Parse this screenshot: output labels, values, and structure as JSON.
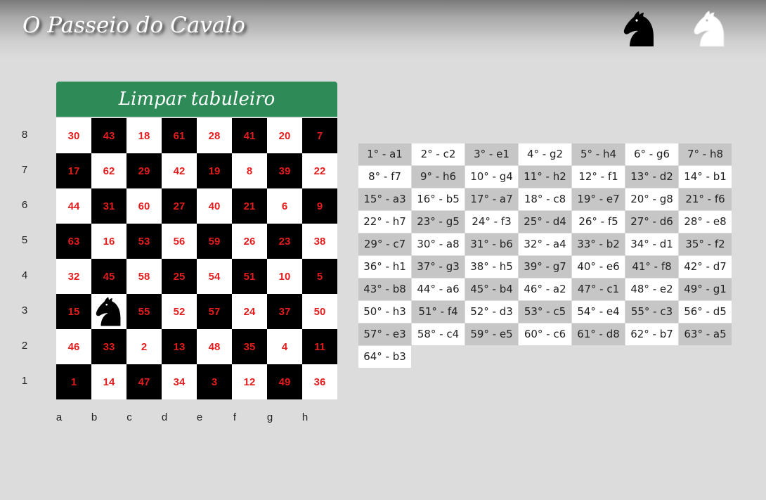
{
  "header": {
    "title": "O Passeio do Cavalo"
  },
  "piece_selectors": [
    {
      "name": "black-knight-icon",
      "color": "#000000"
    },
    {
      "name": "white-knight-icon",
      "color": "#ffffff"
    }
  ],
  "board": {
    "clear_label": "Limpar tabuleiro",
    "ranks": [
      "8",
      "7",
      "6",
      "5",
      "4",
      "3",
      "2",
      "1"
    ],
    "files": [
      "a",
      "b",
      "c",
      "d",
      "e",
      "f",
      "g",
      "h"
    ],
    "rows": [
      [
        "30",
        "43",
        "18",
        "61",
        "28",
        "41",
        "20",
        "7"
      ],
      [
        "17",
        "62",
        "29",
        "42",
        "19",
        "8",
        "39",
        "22"
      ],
      [
        "44",
        "31",
        "60",
        "27",
        "40",
        "21",
        "6",
        "9"
      ],
      [
        "63",
        "16",
        "53",
        "56",
        "59",
        "26",
        "23",
        "38"
      ],
      [
        "32",
        "45",
        "58",
        "25",
        "54",
        "51",
        "10",
        "5"
      ],
      [
        "15",
        "",
        "55",
        "52",
        "57",
        "24",
        "37",
        "50"
      ],
      [
        "46",
        "33",
        "2",
        "13",
        "48",
        "35",
        "4",
        "11"
      ],
      [
        "1",
        "14",
        "47",
        "34",
        "3",
        "12",
        "49",
        "36"
      ]
    ],
    "knight_square": "b3",
    "colors": {
      "light": "#ffffff",
      "dark": "#000000",
      "number": "#e21d1d",
      "button": "#2e8b57"
    }
  },
  "moves": [
    "1° - a1",
    "2° - c2",
    "3° - e1",
    "4° - g2",
    "5° - h4",
    "6° - g6",
    "7° - h8",
    "8° - f7",
    "9° - h6",
    "10° - g4",
    "11° - h2",
    "12° - f1",
    "13° - d2",
    "14° - b1",
    "15° - a3",
    "16° - b5",
    "17° - a7",
    "18° - c8",
    "19° - e7",
    "20° - g8",
    "21° - f6",
    "22° - h7",
    "23° - g5",
    "24° - f3",
    "25° - d4",
    "26° - f5",
    "27° - d6",
    "28° - e8",
    "29° - c7",
    "30° - a8",
    "31° - b6",
    "32° - a4",
    "33° - b2",
    "34° - d1",
    "35° - f2",
    "36° - h1",
    "37° - g3",
    "38° - h5",
    "39° - g7",
    "40° - e6",
    "41° - f8",
    "42° - d7",
    "43° - b8",
    "44° - a6",
    "45° - b4",
    "46° - a2",
    "47° - c1",
    "48° - e2",
    "49° - g1",
    "50° - h3",
    "51° - f4",
    "52° - d3",
    "53° - c5",
    "54° - e4",
    "55° - c3",
    "56° - d5",
    "57° - e3",
    "58° - c4",
    "59° - e5",
    "60° - c6",
    "61° - d8",
    "62° - b7",
    "63° - a5",
    "64° - b3"
  ]
}
